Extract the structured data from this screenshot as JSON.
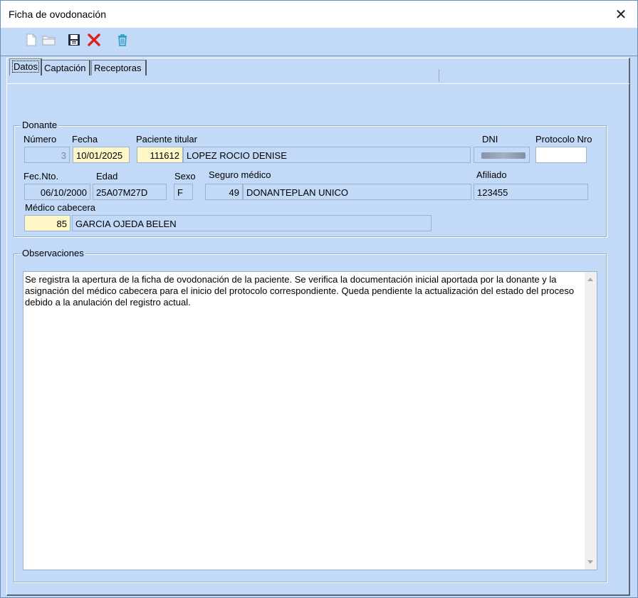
{
  "window": {
    "title": "Ficha de ovodonación",
    "close_glyph": "✕"
  },
  "toolbar": {
    "buttons": [
      {
        "name": "new-icon"
      },
      {
        "name": "open-folder-icon"
      },
      {
        "name": "save-icon"
      },
      {
        "name": "delete-icon"
      },
      {
        "name": "trash-icon"
      }
    ]
  },
  "tabs": [
    {
      "label": "Datos",
      "active": true
    },
    {
      "label": "Captación",
      "active": false
    },
    {
      "label": "Receptoras",
      "active": false
    }
  ],
  "donante": {
    "legend": "Donante",
    "labels": {
      "numero": "Número",
      "fecha": "Fecha",
      "paciente_titular": "Paciente titular",
      "dni": "DNI",
      "protocolo_nro": "Protocolo Nro",
      "fec_nto": "Fec.Nto.",
      "edad": "Edad",
      "sexo": "Sexo",
      "seguro_medico": "Seguro médico",
      "afiliado": "Afiliado",
      "medico_cabecera": "Médico cabecera"
    },
    "values": {
      "numero": "3",
      "fecha": "10/01/2025",
      "paciente_id": "111612",
      "paciente_nombre": "LOPEZ ROCIO DENISE",
      "dni": "",
      "protocolo_nro": "",
      "fec_nto": "06/10/2000",
      "edad": "25A07M27D",
      "sexo": "F",
      "seguro_id": "49",
      "seguro_nombre": "DONANTEPLAN UNICO",
      "afiliado": "123455",
      "medico_id": "85",
      "medico_nombre": "GARCIA OJEDA BELEN"
    }
  },
  "observaciones": {
    "legend": "Observaciones",
    "text": "Se registra la apertura de la ficha de ovodonación de la paciente. Se verifica la documentación inicial aportada por la donante y la asignación del médico cabecera para el inicio del protocolo correspondiente. Queda pendiente la actualización del estado del proceso debido a la anulación del registro actual."
  },
  "colors": {
    "background": "#c2d9f7",
    "highlight_field": "#fff7c8",
    "delete_red": "#e0201c",
    "trash_teal": "#1b9bb8"
  }
}
